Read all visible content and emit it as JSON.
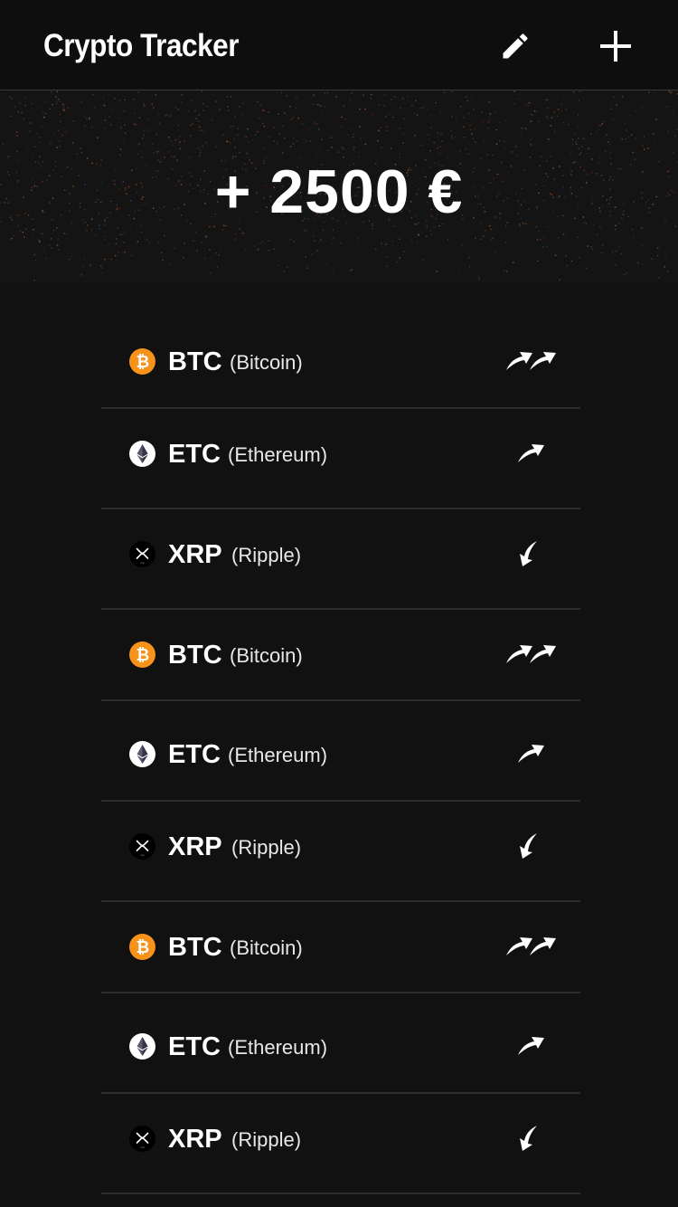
{
  "header": {
    "title": "Crypto Tracker",
    "edit_icon": "pencil-icon",
    "add_icon": "plus-icon"
  },
  "summary": {
    "total": "+ 2500 €"
  },
  "coins": [
    {
      "symbol": "BTC",
      "name": "(Bitcoin)",
      "icon": "bitcoin-icon",
      "trend": "strong-up"
    },
    {
      "symbol": "ETC",
      "name": "(Ethereum)",
      "icon": "ethereum-icon",
      "trend": "up"
    },
    {
      "symbol": "XRP",
      "name": "(Ripple)",
      "icon": "ripple-icon",
      "trend": "down"
    },
    {
      "symbol": "BTC",
      "name": "(Bitcoin)",
      "icon": "bitcoin-icon",
      "trend": "strong-up"
    },
    {
      "symbol": "ETC",
      "name": "(Ethereum)",
      "icon": "ethereum-icon",
      "trend": "up"
    },
    {
      "symbol": "XRP",
      "name": "(Ripple)",
      "icon": "ripple-icon",
      "trend": "down"
    },
    {
      "symbol": "BTC",
      "name": "(Bitcoin)",
      "icon": "bitcoin-icon",
      "trend": "strong-up"
    },
    {
      "symbol": "ETC",
      "name": "(Ethereum)",
      "icon": "ethereum-icon",
      "trend": "up"
    },
    {
      "symbol": "XRP",
      "name": "(Ripple)",
      "icon": "ripple-icon",
      "trend": "down"
    }
  ],
  "colors": {
    "background": "#111111",
    "bitcoin": "#F7931A",
    "divider": "#2c2c2c"
  }
}
